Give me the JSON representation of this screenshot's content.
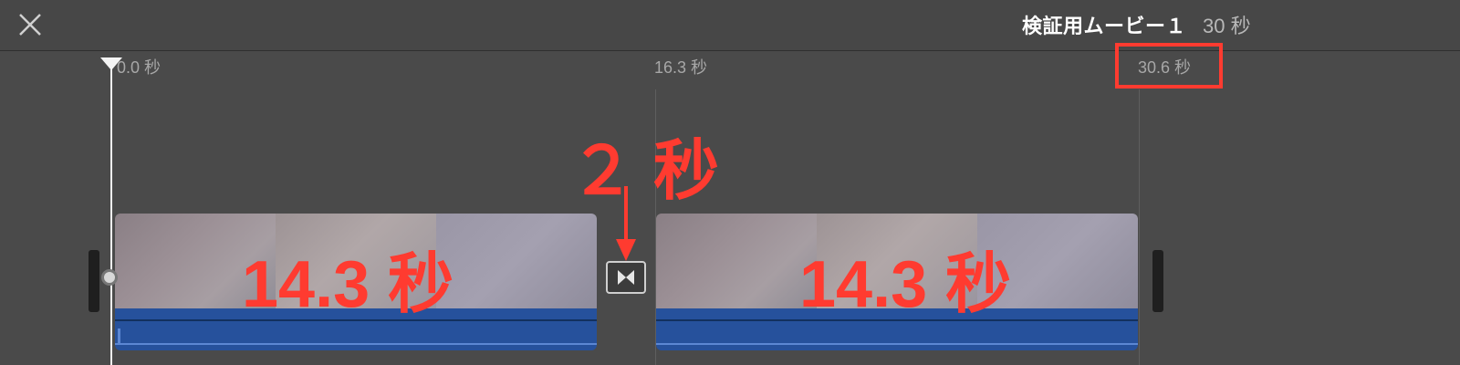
{
  "header": {
    "close_icon": "close-icon",
    "project_title": "検証用ムービー１",
    "project_duration": "30 秒"
  },
  "ruler": {
    "start_label": "0.0 秒",
    "mid_label": "16.3 秒",
    "end_label": "30.6 秒"
  },
  "clips": [
    {
      "duration_label": "14.3 秒"
    },
    {
      "duration_label": "14.3 秒"
    }
  ],
  "transition": {
    "icon": "transition-bowtie-icon"
  },
  "annotations": {
    "transition_duration": "２ 秒",
    "accent_color": "#ff3b30"
  },
  "colors": {
    "background": "#4a4a4a",
    "audio_track": "#26519c"
  }
}
